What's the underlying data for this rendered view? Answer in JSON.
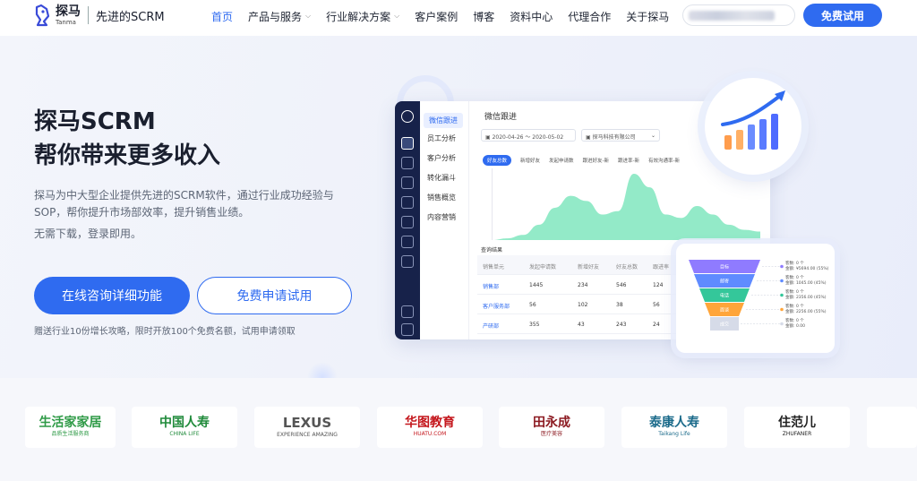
{
  "header": {
    "brand_cn": "探马",
    "brand_en": "Tanma",
    "slogan": "先进的SCRM",
    "nav": [
      {
        "label": "首页",
        "active": true,
        "dropdown": false
      },
      {
        "label": "产品与服务",
        "active": false,
        "dropdown": true
      },
      {
        "label": "行业解决方案",
        "active": false,
        "dropdown": true
      },
      {
        "label": "客户案例",
        "active": false,
        "dropdown": false
      },
      {
        "label": "博客",
        "active": false,
        "dropdown": false
      },
      {
        "label": "资料中心",
        "active": false,
        "dropdown": false
      },
      {
        "label": "代理合作",
        "active": false,
        "dropdown": false
      },
      {
        "label": "关于探马",
        "active": false,
        "dropdown": false
      }
    ],
    "cta_label": "免费试用"
  },
  "hero": {
    "title_line1": "探马SCRM",
    "title_line2": "帮你带来更多收入",
    "description": "探马为中大型企业提供先进的SCRM软件，通过行业成功经验与SOP，帮你提升市场部效率，提升销售业绩。",
    "sub_description": "无需下载，登录即用。",
    "primary_cta": "在线咨询详细功能",
    "secondary_cta": "免费申请试用",
    "note": "赠送行业10份增长攻略，限时开放100个免费名额，试用申请领取"
  },
  "dashboard": {
    "sidebar_icons": [
      "logo-icon",
      "chart-icon",
      "shield-icon",
      "users-icon",
      "target-icon",
      "box-icon",
      "cloud-icon",
      "grid-icon",
      "settings-icon",
      "collapse-icon"
    ],
    "menu": [
      {
        "label": "微信跟进",
        "active": true
      },
      {
        "label": "员工分析",
        "active": false
      },
      {
        "label": "客户分析",
        "active": false
      },
      {
        "label": "转化漏斗",
        "active": false
      },
      {
        "label": "销售概览",
        "active": false
      },
      {
        "label": "内容营销",
        "active": false
      }
    ],
    "title": "微信跟进",
    "date_range": "2020-04-26 ～ 2020-05-02",
    "company": "探马科技有限公司",
    "tabs": [
      {
        "label": "好友总数",
        "active": true
      },
      {
        "label": "新增好友",
        "active": false
      },
      {
        "label": "发起申请数",
        "active": false
      },
      {
        "label": "跟进好友-新",
        "active": false
      },
      {
        "label": "跟进率-新",
        "active": false
      },
      {
        "label": "有效沟通率-新",
        "active": false
      }
    ],
    "chart_data": {
      "type": "area",
      "values": [
        0,
        2,
        6,
        18,
        38,
        52,
        46,
        30,
        34,
        78,
        62,
        30,
        26,
        40,
        30,
        18,
        12,
        10
      ],
      "color": "#6fe3b6"
    },
    "query_label": "查询结果",
    "table": {
      "headers": [
        "销售单元",
        "发起申请数",
        "新增好友",
        "好友总数",
        "跟进率"
      ],
      "rows": [
        [
          "销售部",
          "1445",
          "234",
          "546",
          "124"
        ],
        [
          "客户服务部",
          "56",
          "102",
          "38",
          "56"
        ],
        [
          "产研部",
          "355",
          "43",
          "243",
          "24"
        ]
      ]
    }
  },
  "bar_card": {
    "values": [
      1,
      2,
      3,
      4,
      5
    ],
    "colors": [
      "#ff9d4d",
      "#ffb066",
      "#6b8cff",
      "#5a7bff",
      "#4e6bff"
    ],
    "arrow_color": "#2f6bf0"
  },
  "funnel": {
    "stages": [
      {
        "label": "目标",
        "color": "#8f7bff"
      },
      {
        "label": "邮寄",
        "color": "#5f8bff"
      },
      {
        "label": "电话",
        "color": "#34c79a"
      },
      {
        "label": "面谈",
        "color": "#ffa53a"
      },
      {
        "label": "成交",
        "color": "#d6dbe8"
      }
    ],
    "notes": [
      {
        "count": "客数: 0 个",
        "amount": "金额: ¥5694.00 (55%)"
      },
      {
        "count": "客数: 0 个",
        "amount": "金额: 1045.00 (45%)"
      },
      {
        "count": "客数: 0 个",
        "amount": "金额: 2356.00 (45%)"
      },
      {
        "count": "客数: 0 个",
        "amount": "金额: 2256.00 (55%)"
      },
      {
        "count": "客数: 0 个",
        "amount": "金额: 0.00"
      }
    ]
  },
  "partners": [
    {
      "name": "生活家家居",
      "sub": "品质生活服务商",
      "color": "#2e9a46"
    },
    {
      "name": "中国人寿",
      "sub": "CHINA LIFE",
      "color": "#1f8a3a"
    },
    {
      "name": "LEXUS",
      "sub": "EXPERIENCE AMAZING",
      "color": "#555555"
    },
    {
      "name": "华图教育",
      "sub": "HUATU.COM",
      "color": "#c4161c"
    },
    {
      "name": "田永成",
      "sub": "医疗美容",
      "color": "#8c1b22"
    },
    {
      "name": "泰康人寿",
      "sub": "Taikang Life",
      "color": "#1a6a8a"
    },
    {
      "name": "住范儿",
      "sub": "ZHUFANER",
      "color": "#222222"
    }
  ]
}
